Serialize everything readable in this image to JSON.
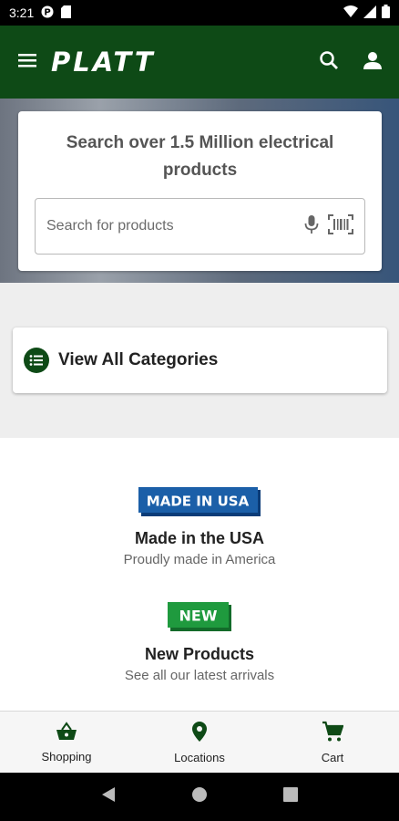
{
  "status_bar": {
    "time": "3:21"
  },
  "app_bar": {
    "logo_text": "PLATT"
  },
  "search": {
    "title": "Search over 1.5 Million electrical products",
    "placeholder": "Search for products"
  },
  "categories": {
    "label": "View All Categories"
  },
  "promos": [
    {
      "badge": "MADE IN USA",
      "title": "Made in the USA",
      "subtitle": "Proudly made in America"
    },
    {
      "badge": "NEW",
      "title": "New Products",
      "subtitle": "See all our latest arrivals"
    }
  ],
  "bottom_nav": [
    {
      "label": "Shopping",
      "icon": "shopping-basket-icon"
    },
    {
      "label": "Locations",
      "icon": "location-pin-icon"
    },
    {
      "label": "Cart",
      "icon": "cart-icon"
    }
  ],
  "colors": {
    "brand_green": "#0e4a16",
    "usa_blue": "#1b5fa8",
    "new_green": "#1f9a3e"
  }
}
